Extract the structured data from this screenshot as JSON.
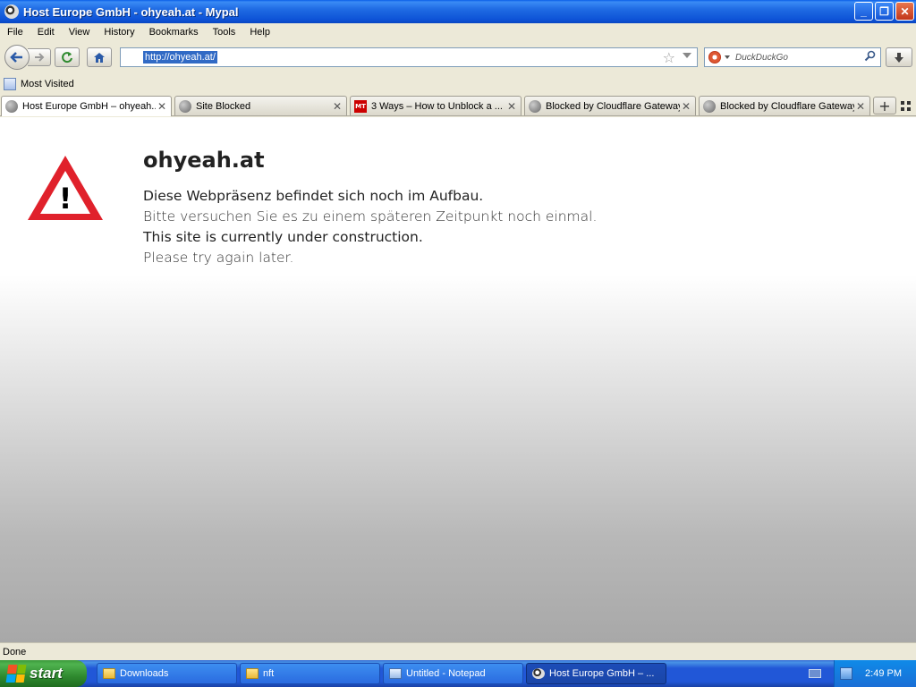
{
  "window": {
    "title": "Host Europe GmbH - ohyeah.at - Mypal",
    "minimize_label": "_",
    "maximize_label": "❐",
    "close_label": "✕"
  },
  "menu": {
    "items": [
      "File",
      "Edit",
      "View",
      "History",
      "Bookmarks",
      "Tools",
      "Help"
    ]
  },
  "nav": {
    "url": "http://ohyeah.at/",
    "search_placeholder": "DuckDuckGo"
  },
  "bookmarks": {
    "most_visited": "Most Visited"
  },
  "tabs": [
    {
      "label": "Host Europe GmbH – ohyeah....",
      "active": true
    },
    {
      "label": "Site Blocked",
      "active": false
    },
    {
      "label": "3 Ways – How to Unblock a ...",
      "active": false,
      "favicon_text": "MT"
    },
    {
      "label": "Blocked by Cloudflare Gateway",
      "active": false
    },
    {
      "label": "Blocked by Cloudflare Gateway",
      "active": false
    }
  ],
  "page": {
    "heading": "ohyeah.at",
    "line1": "Diese Webpräsenz befindet sich noch im Aufbau.",
    "line2": "Bitte versuchen Sie es zu einem späteren Zeitpunkt noch einmal.",
    "line3": "This site is currently under construction.",
    "line4": "Please try again later.",
    "warning_glyph": "!"
  },
  "status": {
    "text": "Done"
  },
  "taskbar": {
    "start_label": "start",
    "tasks": [
      {
        "label": "Downloads"
      },
      {
        "label": "nft"
      },
      {
        "label": "Untitled - Notepad"
      },
      {
        "label": "Host Europe GmbH – ..."
      }
    ],
    "clock": "2:49 PM"
  },
  "colors": {
    "warning_red": "#e0212b",
    "url_highlight": "#316ac5",
    "titlebar_blue": "#0d52d6",
    "start_green": "#3c9a3c"
  }
}
